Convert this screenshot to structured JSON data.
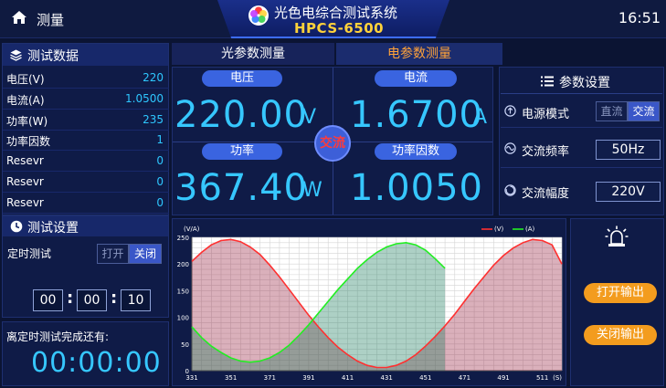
{
  "header": {
    "page_title": "测量",
    "system_title": "光色电综合测试系统",
    "model": "HPCS-6500",
    "clock": "16:51"
  },
  "test_data": {
    "title": "测试数据",
    "rows": [
      {
        "label": "电压(V)",
        "value": "220"
      },
      {
        "label": "电流(A)",
        "value": "1.0500"
      },
      {
        "label": "功率(W)",
        "value": "235"
      },
      {
        "label": "功率因数",
        "value": "1"
      },
      {
        "label": "Resevr",
        "value": "0"
      },
      {
        "label": "Resevr",
        "value": "0"
      },
      {
        "label": "Resevr",
        "value": "0"
      }
    ]
  },
  "test_settings": {
    "title": "测试设置",
    "timer_label": "定时测试",
    "toggle_on": "打开",
    "toggle_off": "关闭",
    "selected": "关闭",
    "hh": "00",
    "mm": "00",
    "ss": "10",
    "remaining_label": "离定时测试完成还有:",
    "remaining": "00:00:00"
  },
  "tabs": {
    "optical": "光参数测量",
    "electrical": "电参数测量",
    "active": "electrical"
  },
  "measure": {
    "voltage_label": "电压",
    "voltage_value": "220.00",
    "voltage_unit": "V",
    "current_label": "电流",
    "current_value": "1.6700",
    "current_unit": "A",
    "power_label": "功率",
    "power_value": "367.40",
    "power_unit": "W",
    "pf_label": "功率因数",
    "pf_value": "1.0050",
    "mode_badge": "交流"
  },
  "params": {
    "title": "参数设置",
    "power_mode_label": "电源模式",
    "mode_dc": "直流",
    "mode_ac": "交流",
    "mode_selected": "交流",
    "freq_label": "交流频率",
    "freq_value": "50Hz",
    "amp_label": "交流幅度",
    "amp_value": "220V"
  },
  "outputs": {
    "open": "打开输出",
    "close": "关闭输出"
  },
  "colors": {
    "accent_blue": "#36c7ff",
    "voltage_series": "#ff3030",
    "current_series": "#22ee22",
    "button_orange": "#f39c1e"
  },
  "chart_data": {
    "type": "line",
    "ylabel": "(V/A)",
    "xlabel": "(S)",
    "ylim": [
      0,
      250
    ],
    "xlim": [
      331,
      521
    ],
    "y_ticks": [
      0,
      50,
      100,
      150,
      200,
      250
    ],
    "x_ticks": [
      331,
      351,
      371,
      391,
      411,
      431,
      451,
      471,
      491,
      511
    ],
    "grid": true,
    "legend_position": "top-right",
    "series": [
      {
        "name": "(V)",
        "color": "#ff3030",
        "x": [
          331,
          336,
          341,
          346,
          351,
          356,
          361,
          366,
          371,
          376,
          381,
          386,
          391,
          396,
          401,
          406,
          411,
          416,
          421,
          426,
          431,
          436,
          441,
          446,
          451,
          456,
          461,
          466,
          471,
          476,
          481,
          486,
          491,
          496,
          501,
          506,
          511,
          516,
          521
        ],
        "values": [
          205,
          222,
          236,
          244,
          246,
          242,
          232,
          218,
          198,
          176,
          152,
          128,
          104,
          82,
          62,
          44,
          30,
          18,
          10,
          6,
          6,
          10,
          18,
          30,
          46,
          64,
          84,
          106,
          130,
          154,
          176,
          198,
          216,
          230,
          240,
          246,
          244,
          236,
          200
        ]
      },
      {
        "name": "(A)",
        "color": "#22ee22",
        "x": [
          331,
          336,
          341,
          346,
          351,
          356,
          361,
          366,
          371,
          376,
          381,
          386,
          391,
          396,
          401,
          406,
          411,
          416,
          421,
          426,
          431,
          436,
          441,
          446,
          451,
          456,
          461
        ],
        "values": [
          82,
          62,
          46,
          34,
          24,
          18,
          16,
          18,
          24,
          34,
          48,
          66,
          86,
          108,
          130,
          152,
          172,
          192,
          208,
          222,
          232,
          238,
          240,
          236,
          226,
          210,
          192
        ]
      }
    ]
  }
}
